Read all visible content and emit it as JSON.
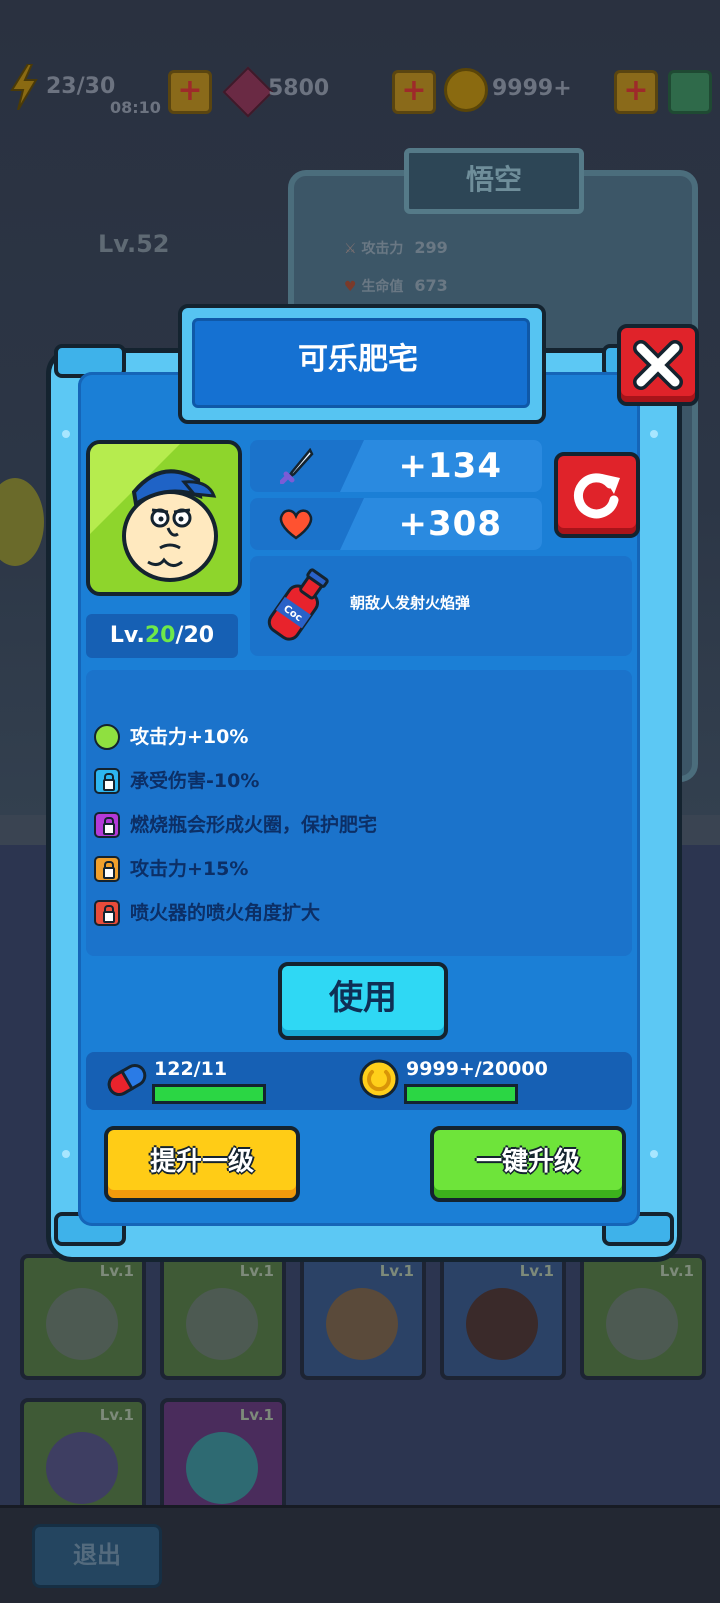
{
  "topbar": {
    "energy": "23/30",
    "timer": "08:10",
    "gems": "5800",
    "coins": "9999+"
  },
  "background": {
    "hero_name": "悟空",
    "hero_level": "Lv.52",
    "stats": [
      {
        "label": "攻击力",
        "value": "299"
      },
      {
        "label": "生命值",
        "value": "673"
      }
    ],
    "card_level": "Lv.1",
    "exit_label": "退出"
  },
  "modal": {
    "title": "可乐肥宅",
    "attack_bonus": "+134",
    "hp_bonus": "+308",
    "level_prefix": "Lv.",
    "level_current": "20",
    "level_max": "/20",
    "skill_description": "朝敌人发射火焰弹",
    "skill_item_text": "Coc",
    "perks": [
      {
        "text": "攻击力+10%",
        "unlocked": true
      },
      {
        "text": "承受伤害-10%",
        "unlocked": false
      },
      {
        "text": "燃烧瓶会形成火圈，保护肥宅",
        "unlocked": false
      },
      {
        "text": "攻击力+15%",
        "unlocked": false
      },
      {
        "text": "喷火器的喷火角度扩大",
        "unlocked": false
      }
    ],
    "use_label": "使用",
    "pills_progress": "122/11",
    "coins_progress": "9999+/20000",
    "upgrade_one_label": "提升一级",
    "upgrade_max_label": "一键升级"
  },
  "colors": {
    "accent_blue": "#1b7fd6",
    "close_red": "#e0232a",
    "level_green": "#6ee84a",
    "button_yellow": "#ffcc16",
    "button_green": "#6ee43a"
  },
  "icons": [
    "lightning-icon",
    "gem-icon",
    "coin-icon",
    "plus-icon",
    "shield-icon",
    "close-icon",
    "sword-icon",
    "heart-icon",
    "refresh-icon",
    "cola-bottle-icon",
    "lock-icon",
    "pill-icon"
  ]
}
